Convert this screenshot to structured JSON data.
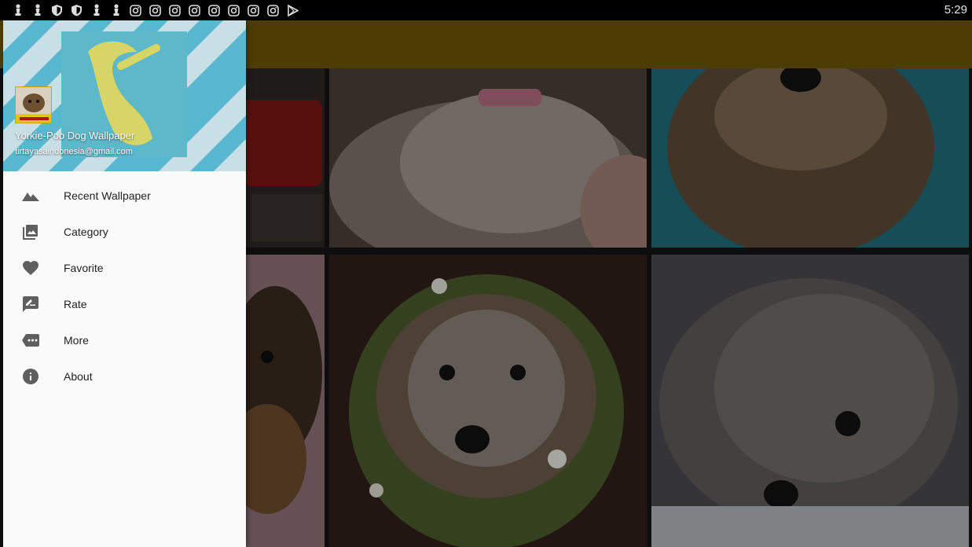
{
  "status_bar": {
    "time": "5:29",
    "icons": [
      "chess-pawn-icon",
      "chess-pawn-icon",
      "shield-icon",
      "shield-icon",
      "chess-pawn-icon",
      "chess-pawn-icon",
      "instagram-icon",
      "instagram-icon",
      "instagram-icon",
      "instagram-icon",
      "instagram-icon",
      "instagram-icon",
      "instagram-icon",
      "instagram-icon",
      "play-store-icon"
    ]
  },
  "drawer": {
    "app_name": "Yorkie-Poo Dog Wallpaper",
    "email": "tirtayasaindonesia@gmail.com",
    "menu": [
      {
        "label": "Recent Wallpaper",
        "icon": "landscape-icon"
      },
      {
        "label": "Category",
        "icon": "photo-library-icon"
      },
      {
        "label": "Favorite",
        "icon": "heart-icon"
      },
      {
        "label": "Rate",
        "icon": "rate-review-icon"
      },
      {
        "label": "More",
        "icon": "more-label-icon"
      },
      {
        "label": "About",
        "icon": "info-icon"
      }
    ]
  },
  "colors": {
    "toolbar": "#6b5508",
    "drawer_bg": "#fafafa",
    "icon": "#5f5f5f"
  }
}
